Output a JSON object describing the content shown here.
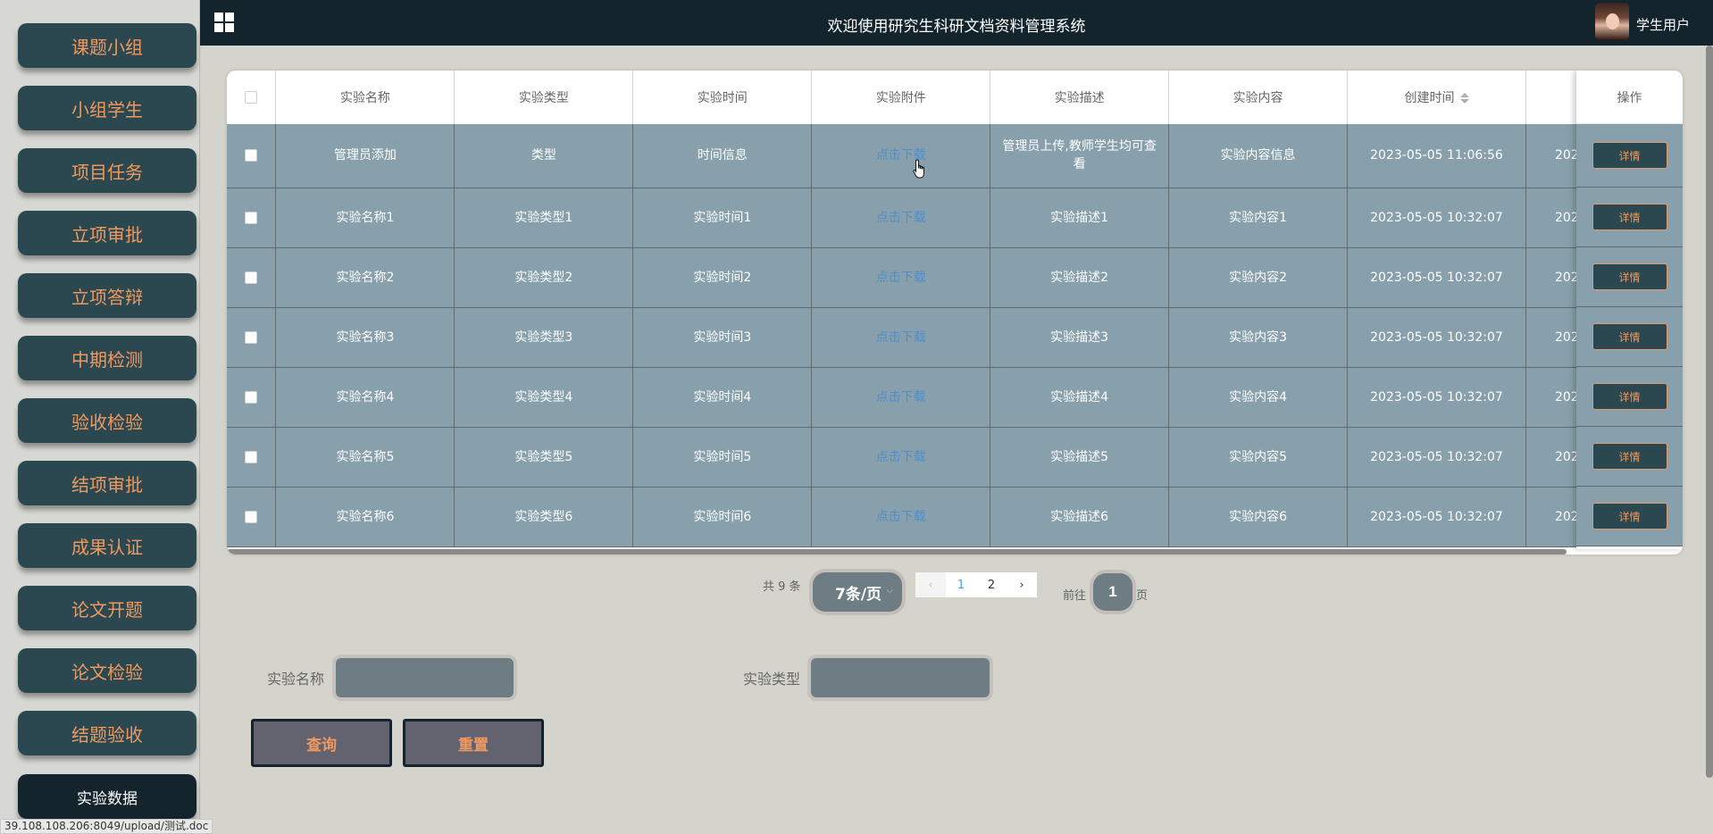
{
  "app": {
    "title": "欢迎使用研究生科研文档资料管理系统",
    "user": "学生用户"
  },
  "sidebar": {
    "items": [
      {
        "label": "课题小组",
        "active": false
      },
      {
        "label": "小组学生",
        "active": false
      },
      {
        "label": "项目任务",
        "active": false
      },
      {
        "label": "立项审批",
        "active": false
      },
      {
        "label": "立项答辩",
        "active": false
      },
      {
        "label": "中期检测",
        "active": false
      },
      {
        "label": "验收检验",
        "active": false
      },
      {
        "label": "结项审批",
        "active": false
      },
      {
        "label": "成果认证",
        "active": false
      },
      {
        "label": "论文开题",
        "active": false
      },
      {
        "label": "论文检验",
        "active": false
      },
      {
        "label": "结题验收",
        "active": false
      },
      {
        "label": "实验数据",
        "active": true
      }
    ]
  },
  "table": {
    "columns": [
      "实验名称",
      "实验类型",
      "实验时间",
      "实验附件",
      "实验描述",
      "实验内容",
      "创建时间"
    ],
    "action_header": "操作",
    "detail_label": "详情",
    "rows": [
      {
        "name": "管理员添加",
        "type": "类型",
        "time": "时间信息",
        "attachment": "点击下载",
        "desc": "管理员上传,教师学生均可查看",
        "content": "实验内容信息",
        "created": "2023-05-05 11:06:56",
        "created_trunc": "202"
      },
      {
        "name": "实验名称1",
        "type": "实验类型1",
        "time": "实验时间1",
        "attachment": "点击下载",
        "desc": "实验描述1",
        "content": "实验内容1",
        "created": "2023-05-05 10:32:07",
        "created_trunc": "202"
      },
      {
        "name": "实验名称2",
        "type": "实验类型2",
        "time": "实验时间2",
        "attachment": "点击下载",
        "desc": "实验描述2",
        "content": "实验内容2",
        "created": "2023-05-05 10:32:07",
        "created_trunc": "202"
      },
      {
        "name": "实验名称3",
        "type": "实验类型3",
        "time": "实验时间3",
        "attachment": "点击下载",
        "desc": "实验描述3",
        "content": "实验内容3",
        "created": "2023-05-05 10:32:07",
        "created_trunc": "202"
      },
      {
        "name": "实验名称4",
        "type": "实验类型4",
        "time": "实验时间4",
        "attachment": "点击下载",
        "desc": "实验描述4",
        "content": "实验内容4",
        "created": "2023-05-05 10:32:07",
        "created_trunc": "202"
      },
      {
        "name": "实验名称5",
        "type": "实验类型5",
        "time": "实验时间5",
        "attachment": "点击下载",
        "desc": "实验描述5",
        "content": "实验内容5",
        "created": "2023-05-05 10:32:07",
        "created_trunc": "202"
      },
      {
        "name": "实验名称6",
        "type": "实验类型6",
        "time": "实验时间6",
        "attachment": "点击下载",
        "desc": "实验描述6",
        "content": "实验内容6",
        "created": "2023-05-05 10:32:07",
        "created_trunc": "202"
      }
    ]
  },
  "pagination": {
    "total": "共 9 条",
    "page_size": "7条/页",
    "pages": [
      "1",
      "2"
    ],
    "current_page": "1",
    "goto_label": "前往",
    "goto_value": "1",
    "page_suffix": "页"
  },
  "search": {
    "name_label": "实验名称",
    "type_label": "实验类型",
    "name_value": "",
    "type_value": "",
    "query_label": "查询",
    "reset_label": "重置"
  },
  "status_bar": {
    "url": "39.108.108.206:8049/upload/测试.doc"
  }
}
